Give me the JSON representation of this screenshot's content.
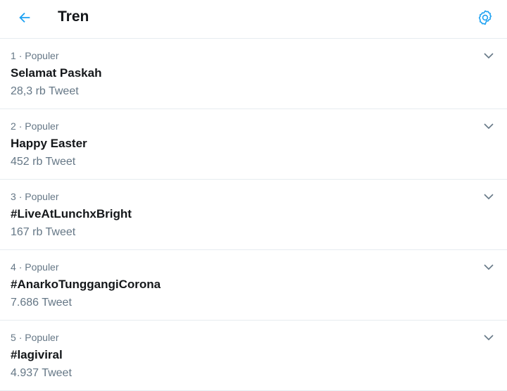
{
  "header": {
    "title": "Tren",
    "back_icon": "arrow-left-icon",
    "settings_icon": "gear-icon",
    "accent_color": "#1da1f2"
  },
  "trends": [
    {
      "rank": "1",
      "sep": "·",
      "category": "Populer",
      "name": "Selamat Paskah",
      "count": "28,3 rb Tweet"
    },
    {
      "rank": "2",
      "sep": "·",
      "category": "Populer",
      "name": "Happy Easter",
      "count": "452 rb Tweet"
    },
    {
      "rank": "3",
      "sep": "·",
      "category": "Populer",
      "name": "#LiveAtLunchxBright",
      "count": "167 rb Tweet"
    },
    {
      "rank": "4",
      "sep": "·",
      "category": "Populer",
      "name": "#AnarkoTunggangiCorona",
      "count": "7.686 Tweet"
    },
    {
      "rank": "5",
      "sep": "·",
      "category": "Populer",
      "name": "#lagiviral",
      "count": "4.937 Tweet"
    }
  ],
  "caret_icon": "chevron-down-icon"
}
